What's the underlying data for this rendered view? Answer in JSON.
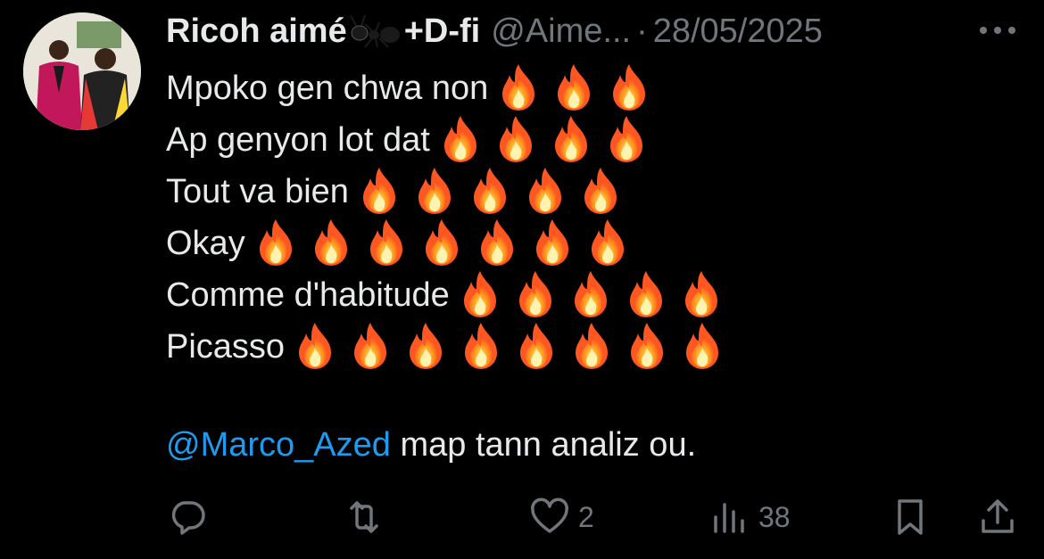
{
  "author": {
    "display_name_prefix": "Ricoh aimé",
    "display_name_suffix": "+D-fi",
    "handle": "@Aime...",
    "separator": "·",
    "date": "28/05/2025",
    "name_emoji": "ant-icon"
  },
  "body": {
    "lines": [
      {
        "text": "Mpoko gen chwa non",
        "flames": 3
      },
      {
        "text": "Ap genyon lot dat",
        "flames": 4
      },
      {
        "text": "Tout va bien",
        "flames": 5
      },
      {
        "text": "Okay",
        "flames": 7
      },
      {
        "text": "Comme d'habitude",
        "flames": 5
      },
      {
        "text": "Picasso",
        "flames": 8
      }
    ],
    "mention": "@Marco_Azed",
    "mention_rest": " map tann analiz ou."
  },
  "actions": {
    "reply_count": "",
    "retweet_count": "",
    "like_count": "2",
    "views_count": "38"
  },
  "colors": {
    "background": "#000000",
    "text": "#e7e9ea",
    "muted": "#71767b",
    "link": "#1d9bf0"
  }
}
